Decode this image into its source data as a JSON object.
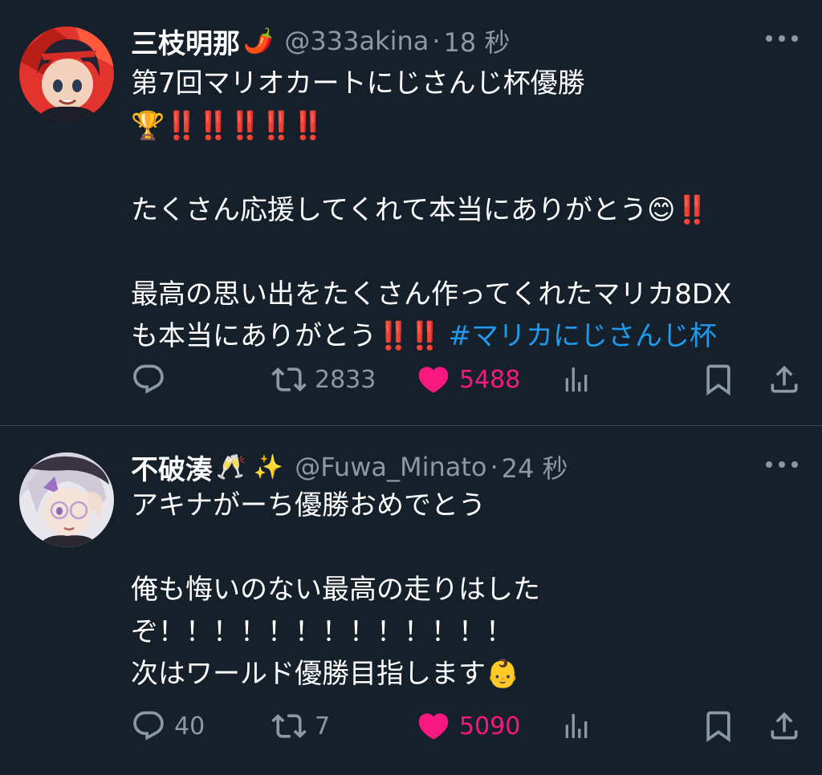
{
  "tweets": [
    {
      "display_name": "三枝明那",
      "name_emoji": "🌶️",
      "handle": "@333akina",
      "separator": "·",
      "time": "18 秒",
      "text_line1": "第7回マリオカートにじさんじ杯優勝",
      "trophy": "🏆",
      "bangs": "‼️‼️‼️‼️‼️",
      "text_line3": "たくさん応援してくれて本当にありがとう",
      "smile_emoji": "😊",
      "bang_single": "‼️",
      "text_line5": "最高の思い出をたくさん作ってくれたマリカ8DX",
      "text_line6": "も本当にありがとう",
      "bang_double": "‼️‼️",
      "hashtag": "#マリカにじさんじ杯",
      "reply_count": "",
      "retweet_count": "2833",
      "like_count": "5488"
    },
    {
      "display_name": "不破湊",
      "name_emoji": "🥂 ✨",
      "handle": "@Fuwa_Minato",
      "separator": "·",
      "time": "24 秒",
      "text_line1": "アキナがーち優勝おめでとう",
      "text_line3": "俺も悔いのない最高の走りはした",
      "text_line4": "ぞ！！！！！！！！！！！！！",
      "text_line5": "次はワールド優勝目指します",
      "baby_emoji": "👶",
      "reply_count": "40",
      "retweet_count": "7",
      "like_count": "5090"
    }
  ],
  "icons": [
    "reply-icon",
    "retweet-icon",
    "heart-icon",
    "views-icon",
    "bookmark-icon",
    "share-icon",
    "more-icon"
  ],
  "colors": {
    "background": "#15202b",
    "text": "#ffffff",
    "secondary": "#8b98a5",
    "like": "#f91880",
    "hashtag": "#1d9bf0",
    "divider": "#38444d"
  }
}
